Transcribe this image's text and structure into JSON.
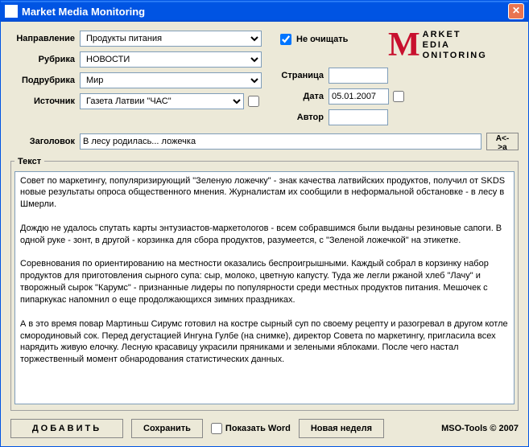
{
  "titlebar": {
    "title": "Market Media Monitoring"
  },
  "labels": {
    "direction": "Направление",
    "rubric": "Рубрика",
    "subrubric": "Подрубрика",
    "source": "Источник",
    "page": "Страница",
    "date": "Дата",
    "author": "Автор",
    "title": "Заголовок",
    "text_legend": "Текст"
  },
  "fields": {
    "direction": "Продукты питания",
    "rubric": "НОВОСТИ",
    "subrubric": "Мир",
    "source": "Газета Латвии \"ЧАС\"",
    "page": "",
    "date": "05.01.2007",
    "author": "",
    "title": "В лесу родилась... ложечка"
  },
  "noclear": {
    "label": "Не очищать",
    "checked": true
  },
  "logo": {
    "m": "M",
    "line1": "ARKET",
    "line2": "EDIA",
    "line3": "ONITORING"
  },
  "buttons": {
    "ak": "A<->a",
    "add": "ДОБАВИТЬ",
    "save": "Сохранить",
    "show_word": "Показать Word",
    "new_week": "Новая неделя"
  },
  "footer": "MSO-Tools © 2007",
  "text_body": "Совет по маркетингу, популяризирующий \"Зеленую ложечку\" - знак качества латвийских продуктов, получил от SKDS новые результаты опроса общественного мнения. Журналистам их сообщили в неформальной обстановке - в лесу в Шмерли.\n\nДождю не удалось спутать карты энтузиастов-маркетологов - всем собравшимся были выданы резиновые сапоги. В одной руке - зонт, в другой - корзинка для сбора продуктов, разумеется, с \"Зеленой ложечкой\" на этикетке.\n\nСоревнования по ориентированию на местности оказались беспроигрышными. Каждый собрал в корзинку набор продуктов для приготовления сырного супа: сыр, молоко, цветную капусту. Туда же легли ржаной хлеб \"Лачу\" и творожный сырок \"Карумс\" - признанные лидеры по популярности среди местных продуктов питания. Мешочек с пипаркукас напомнил о еще продолжающихся зимних праздниках.\n\nА в это время повар Мартиньш Сирумс готовил на костре сырный суп по своему рецепту и разогревал в другом котле смородиновый сок. Перед дегустацией Ингуна Гулбе (на снимке), директор Совета по маркетингу, пригласила всех нарядить живую елочку. Лесную красавицу украсили пряниками и зелеными яблоками. После чего настал торжественный момент обнародования статистических данных."
}
